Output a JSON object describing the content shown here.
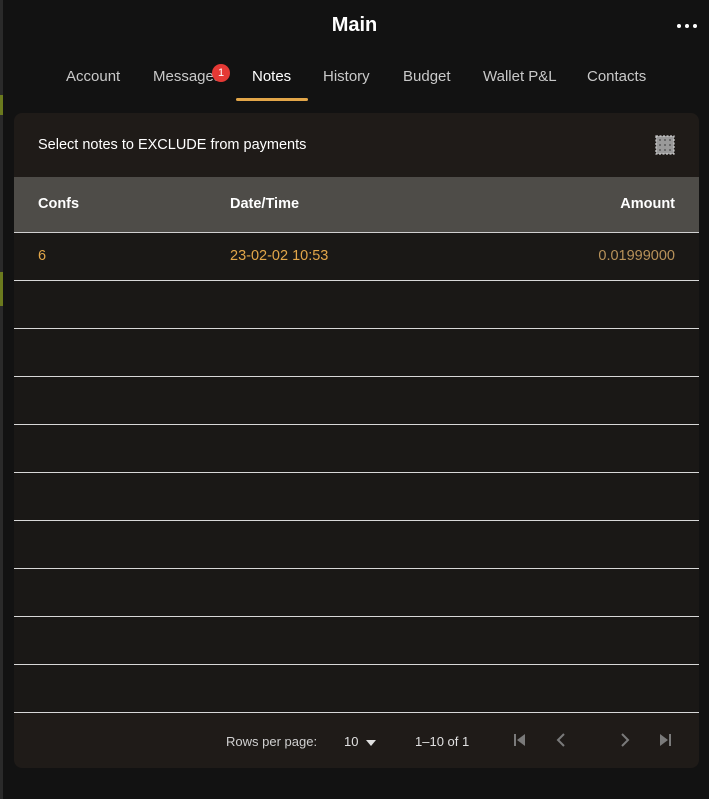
{
  "header": {
    "title": "Main",
    "more_icon": "more-horizontal-icon"
  },
  "tabs": [
    {
      "label": "Account",
      "active": false
    },
    {
      "label": "Messages",
      "active": false,
      "badge": "1"
    },
    {
      "label": "Notes",
      "active": true
    },
    {
      "label": "History",
      "active": false
    },
    {
      "label": "Budget",
      "active": false
    },
    {
      "label": "Wallet P&L",
      "active": false
    },
    {
      "label": "Contacts",
      "active": false
    }
  ],
  "notes_card": {
    "title": "Select notes to EXCLUDE from payments",
    "select_all_icon": "checkbox-grid-icon",
    "columns": {
      "confs": "Confs",
      "datetime": "Date/Time",
      "amount": "Amount"
    },
    "rows": [
      {
        "confs": "6",
        "datetime": "23-02-02 10:53",
        "amount": "0.01999000"
      }
    ],
    "empty_rows": 9
  },
  "pagination": {
    "rows_per_page_label": "Rows per page:",
    "rows_per_page_value": "10",
    "range": "1–10 of 1",
    "icons": [
      "first-page-icon",
      "previous-page-icon",
      "next-page-icon",
      "last-page-icon"
    ]
  },
  "colors": {
    "accent": "#e2a649",
    "badge": "#e53935",
    "header_row": "#4e4c48",
    "card": "#1f1b18"
  }
}
